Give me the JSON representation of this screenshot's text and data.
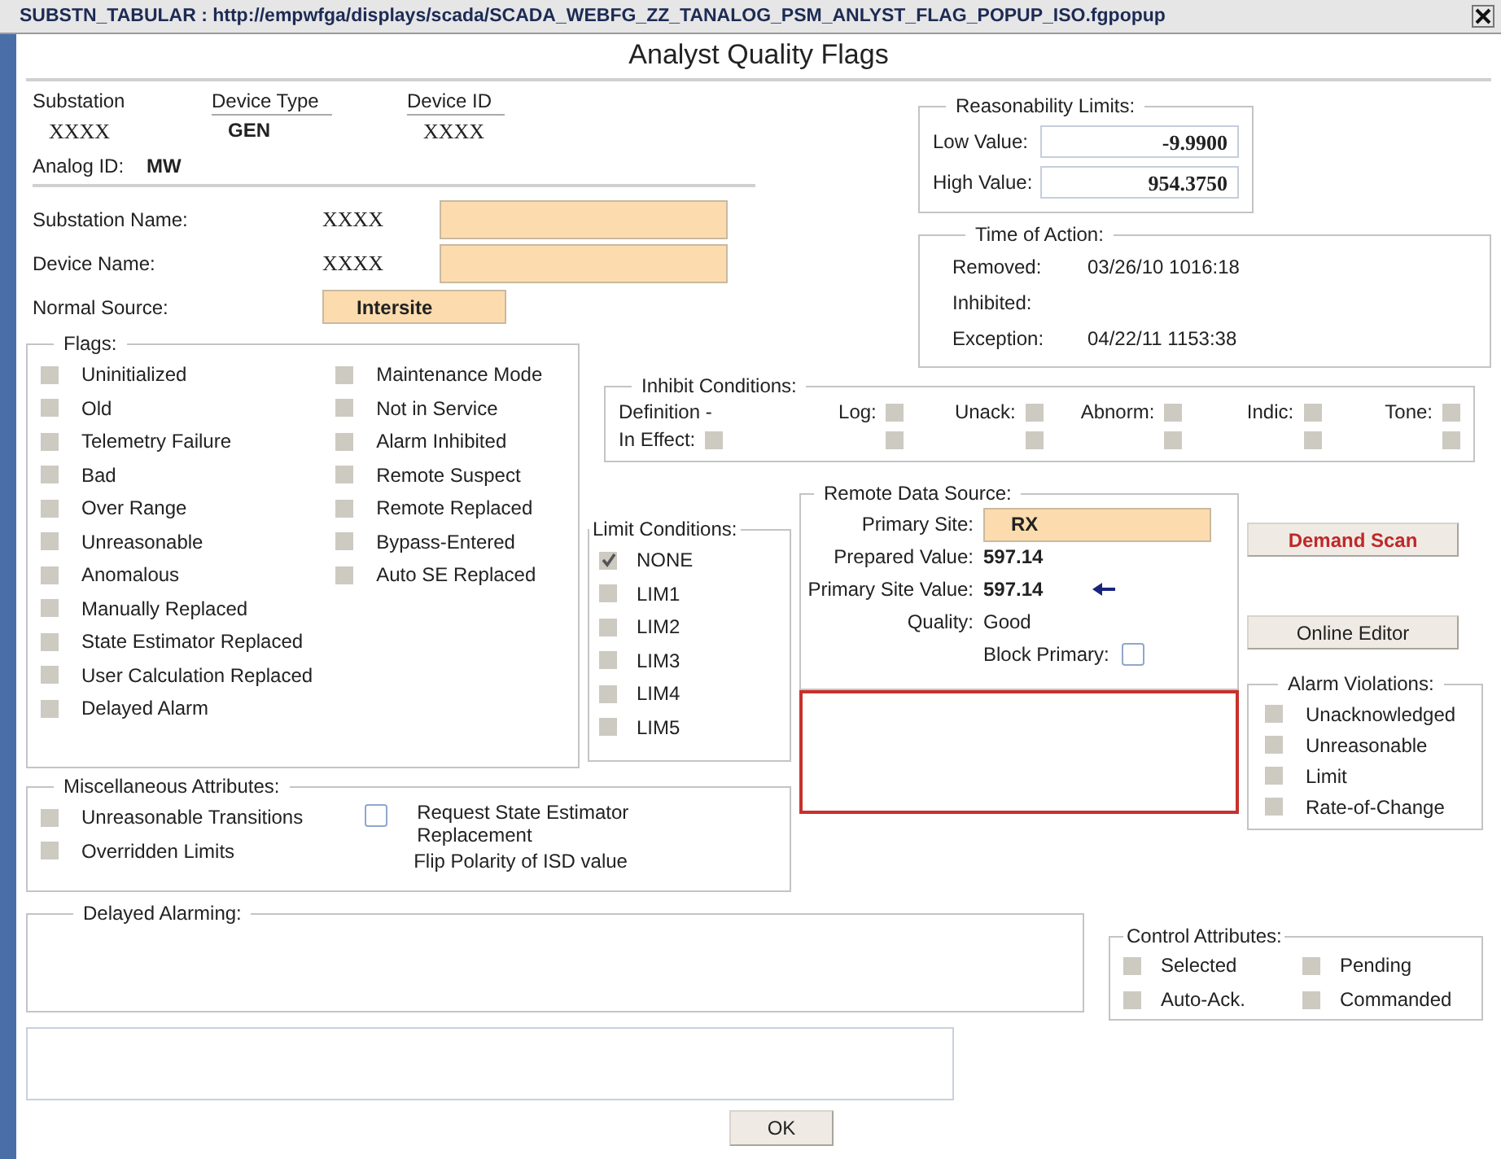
{
  "window": {
    "title": "SUBSTN_TABULAR : http://empwfga/displays/scada/SCADA_WEBFG_ZZ_TANALOG_PSM_ANLYST_FLAG_POPUP_ISO.fgpopup"
  },
  "heading": "Analyst Quality Flags",
  "identity": {
    "columns": [
      {
        "label": "Substation",
        "value": "XXXX"
      },
      {
        "label": "Device Type",
        "value": "GEN"
      },
      {
        "label": "Device ID",
        "value": "XXXX"
      }
    ],
    "analog_id": {
      "label": "Analog ID:",
      "value": "MW"
    }
  },
  "names": [
    {
      "label": "Substation Name:",
      "value": "XXXX"
    },
    {
      "label": "Device Name:",
      "value": "XXXX"
    }
  ],
  "normal_source": {
    "label": "Normal Source:",
    "value": "Intersite"
  },
  "reasonability_limits": {
    "title": "Reasonability Limits:",
    "rows": [
      {
        "label": "Low Value:",
        "value": "-9.9900"
      },
      {
        "label": "High Value:",
        "value": "954.3750"
      }
    ]
  },
  "time_of_action": {
    "title": "Time of Action:",
    "rows": [
      {
        "label": "Removed:",
        "value": "03/26/10 1016:18"
      },
      {
        "label": "Inhibited:"
      },
      {
        "label": "Exception:",
        "value": "04/22/11 1153:38"
      }
    ]
  },
  "flags": {
    "title": "Flags:",
    "columns": [
      [
        {
          "label": "Uninitialized",
          "checked": false
        },
        {
          "label": "Old",
          "checked": false
        },
        {
          "label": "Telemetry Failure",
          "checked": false
        },
        {
          "label": "Bad",
          "checked": false
        },
        {
          "label": "Over Range",
          "checked": false
        },
        {
          "label": "Unreasonable",
          "checked": false
        },
        {
          "label": "Anomalous",
          "checked": false
        },
        {
          "label": "Manually Replaced",
          "checked": false
        },
        {
          "label": "State Estimator Replaced",
          "checked": false
        },
        {
          "label": "User Calculation Replaced",
          "checked": false
        },
        {
          "label": "Delayed Alarm",
          "checked": false
        }
      ],
      [
        {
          "label": "Maintenance Mode",
          "checked": false
        },
        {
          "label": "Not in Service",
          "checked": false
        },
        {
          "label": "Alarm Inhibited",
          "checked": false
        },
        {
          "label": "Remote Suspect",
          "checked": false
        },
        {
          "label": "Remote Replaced",
          "checked": false
        },
        {
          "label": "Bypass-Entered",
          "checked": false
        },
        {
          "label": "Auto SE Replaced",
          "checked": false
        }
      ]
    ]
  },
  "inhibit_conditions": {
    "title": "Inhibit Conditions:",
    "definition": {
      "label": "Definition -"
    },
    "in_effect": {
      "label": "In Effect:",
      "checked": false
    },
    "columns": [
      {
        "label": "Log:",
        "definition_checked": false,
        "in_effect_checked": false
      },
      {
        "label": "Unack:",
        "definition_checked": false,
        "in_effect_checked": false
      },
      {
        "label": "Abnorm:",
        "definition_checked": false,
        "in_effect_checked": false
      },
      {
        "label": "Indic:",
        "definition_checked": false,
        "in_effect_checked": false
      },
      {
        "label": "Tone:",
        "definition_checked": false,
        "in_effect_checked": false
      }
    ]
  },
  "limit_conditions": {
    "title": "Limit Conditions:",
    "items": [
      {
        "label": "NONE",
        "checked": true
      },
      {
        "label": "LIM1",
        "checked": false
      },
      {
        "label": "LIM2",
        "checked": false
      },
      {
        "label": "LIM3",
        "checked": false
      },
      {
        "label": "LIM4",
        "checked": false
      },
      {
        "label": "LIM5",
        "checked": false
      }
    ]
  },
  "remote_data_source": {
    "title": "Remote Data Source:",
    "rows": [
      {
        "kind": "field",
        "label": "Primary Site:",
        "value": "RX"
      },
      {
        "kind": "value",
        "label": "Prepared Value:",
        "value": "597.14"
      },
      {
        "kind": "indicator",
        "label": "Primary Site Value:",
        "value": "597.14"
      },
      {
        "kind": "plain",
        "label": "Quality:",
        "value": "Good"
      },
      {
        "kind": "checkbox",
        "label": "Block Primary:",
        "checked": false
      }
    ]
  },
  "buttons": [
    {
      "label": "Demand Scan",
      "kind": "alert"
    },
    {
      "label": "Online Editor",
      "kind": "normal"
    }
  ],
  "alarm_violations": {
    "title": "Alarm Violations:",
    "items": [
      {
        "label": "Unacknowledged",
        "checked": false
      },
      {
        "label": "Unreasonable",
        "checked": false
      },
      {
        "label": "Limit",
        "checked": false
      },
      {
        "label": "Rate-of-Change",
        "checked": false
      }
    ]
  },
  "misc_attributes": {
    "title": "Miscellaneous Attributes:",
    "columns": [
      [
        {
          "kind": "grey",
          "label": "Unreasonable Transitions",
          "checked": false
        },
        {
          "kind": "grey",
          "label": "Overridden Limits",
          "checked": false
        }
      ],
      [
        {
          "kind": "white",
          "label": "Request State Estimator Replacement",
          "checked": false
        },
        {
          "kind": "text",
          "label": "Flip Polarity of ISD value"
        }
      ]
    ]
  },
  "delayed_alarming": {
    "title": "Delayed Alarming:"
  },
  "control_attributes": {
    "title": "Control Attributes:",
    "items": [
      {
        "label": "Selected",
        "checked": false
      },
      {
        "label": "Pending",
        "checked": false
      },
      {
        "label": "Auto-Ack.",
        "checked": false
      },
      {
        "label": "Commanded",
        "checked": false
      }
    ]
  },
  "ok_button": "OK"
}
